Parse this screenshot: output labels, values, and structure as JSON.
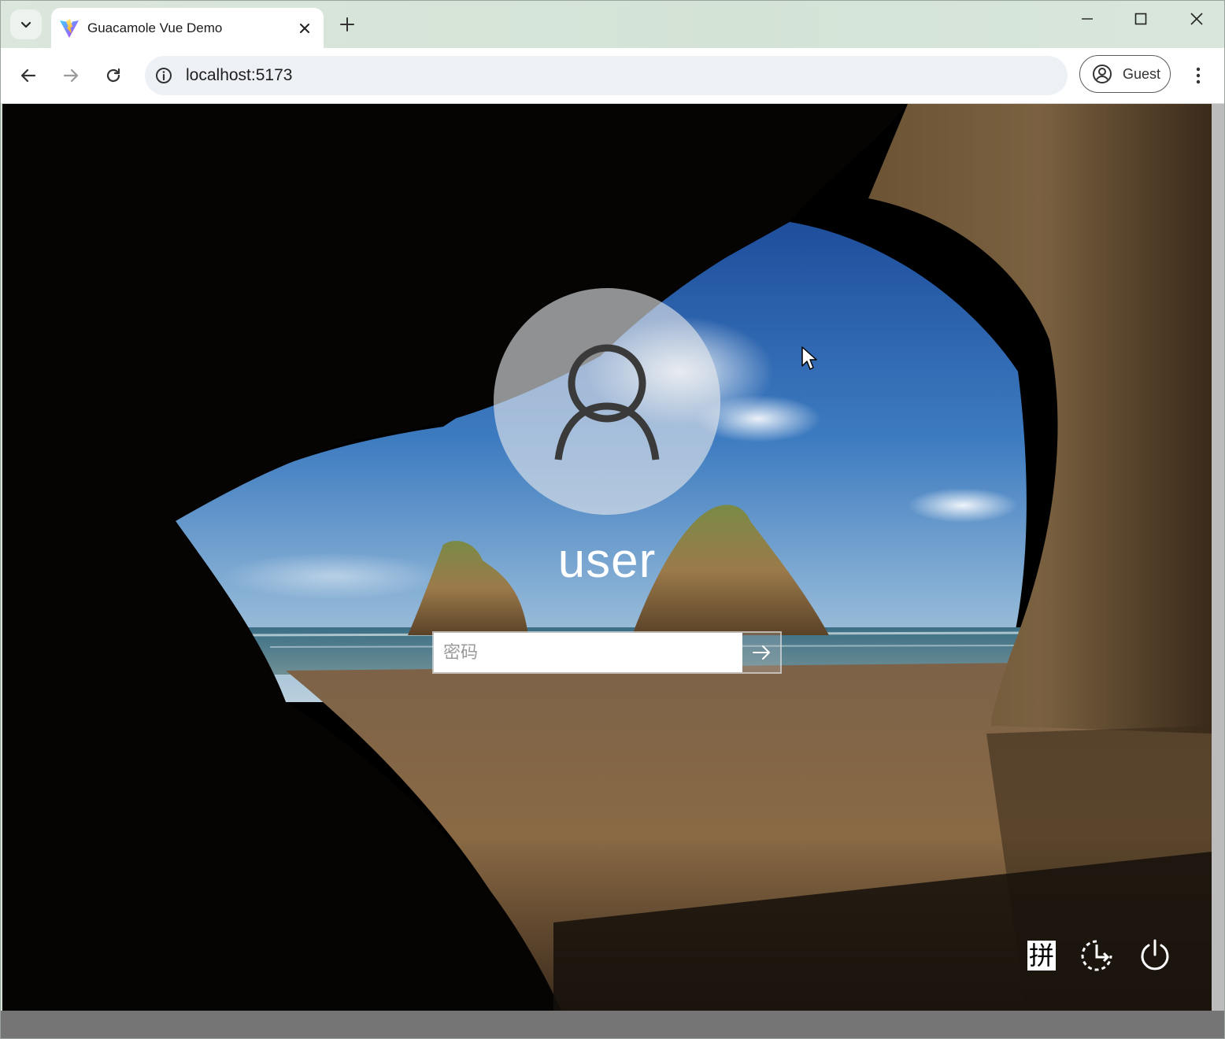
{
  "browser": {
    "tab": {
      "title": "Guacamole Vue Demo"
    },
    "address": {
      "url": "localhost:5173"
    },
    "profile": {
      "label": "Guest"
    }
  },
  "lockscreen": {
    "username": "user",
    "password": {
      "placeholder": "密码",
      "value": ""
    },
    "ime_indicator": "拼"
  },
  "icons": {
    "tab_search": "chevron-down-icon",
    "favicon": "vite-logo-icon",
    "close_tab": "close-icon",
    "new_tab": "plus-icon",
    "minimize": "minimize-icon",
    "maximize": "maximize-icon",
    "close_window": "close-icon",
    "back": "arrow-left-icon",
    "forward": "arrow-right-icon",
    "reload": "reload-icon",
    "site_info": "info-icon",
    "profile": "account-circle-icon",
    "menu": "kebab-menu-icon",
    "avatar": "user-silhouette-icon",
    "submit": "arrow-right-icon",
    "ease_of_access": "ease-of-access-icon",
    "power": "power-icon",
    "pointer": "mouse-pointer-icon"
  },
  "colors": {
    "tabstrip": "#d5e3d8",
    "omnibox": "#edf1f6",
    "sky": "#2a5fb0",
    "sand": "#8a6a45"
  }
}
